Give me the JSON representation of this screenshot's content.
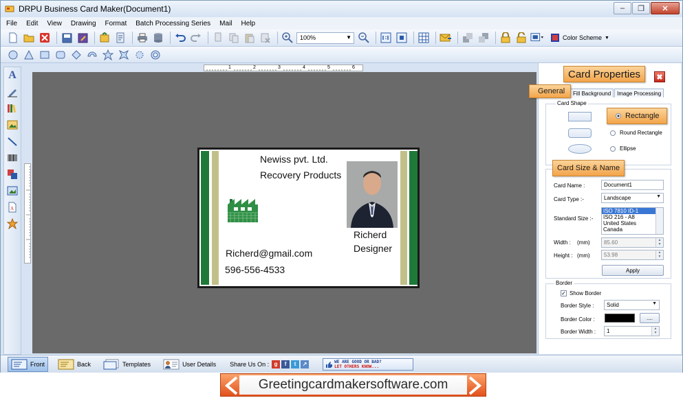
{
  "window": {
    "title": "DRPU Business Card Maker(Document1)"
  },
  "menu": [
    "File",
    "Edit",
    "View",
    "Drawing",
    "Format",
    "Batch Processing Series",
    "Mail",
    "Help"
  ],
  "toolbar": {
    "zoom": "100%",
    "color_scheme": "Color Scheme"
  },
  "ruler": {
    "marks": [
      "1",
      "2",
      "3",
      "4",
      "5",
      "6"
    ]
  },
  "card": {
    "company": "Newiss pvt. Ltd.",
    "tagline": "Recovery Products",
    "name": "Richerd",
    "role": "Designer",
    "email": "Richerd@gmail.com",
    "phone": "596-556-4533"
  },
  "panel": {
    "title": "Card Properties",
    "tabs": [
      "General",
      "Fill Background",
      "Image Processing"
    ],
    "card_shape": {
      "title": "Card Shape",
      "options": [
        "Rectangle",
        "Round Rectangle",
        "Ellipse"
      ],
      "selected": "Rectangle"
    },
    "size_name": {
      "title": "Card Size & Name",
      "card_name_label": "Card Name :",
      "card_name_value": "Document1",
      "card_type_label": "Card Type :-",
      "card_type_value": "Landscape",
      "standard_size_label": "Standard Size :-",
      "standard_sizes": [
        "ISO 7810 ID-1",
        "ISO 216 - A8",
        "United States",
        "Canada"
      ],
      "width_label": "Width :",
      "width_unit": "(mm)",
      "width_value": "85.60",
      "height_label": "Height :",
      "height_unit": "(mm)",
      "height_value": "53.98",
      "apply_label": "Apply"
    },
    "border": {
      "title": "Border",
      "show_border_label": "Show Border",
      "show_border": true,
      "style_label": "Border Style :",
      "style_value": "Solid",
      "color_label": "Border Color :",
      "color_value": "#000000",
      "color_button": "....",
      "width_label": "Border Width :",
      "width_value": "1"
    }
  },
  "bottom": {
    "front": "Front",
    "back": "Back",
    "templates": "Templates",
    "user_details": "User Details",
    "share_label": "Share Us On :",
    "feedback_line1": "WE ARE GOOD OR BAD?",
    "feedback_line2": "LET OTHERS KNOW..."
  },
  "banner": {
    "text": "Greetingcardmakersoftware.com"
  },
  "colors": {
    "stripe_green": "#1f7a3a",
    "stripe_khaki": "#c2c08a",
    "callout_orange": "#f3a44a",
    "banner_orange": "#e2511c"
  }
}
